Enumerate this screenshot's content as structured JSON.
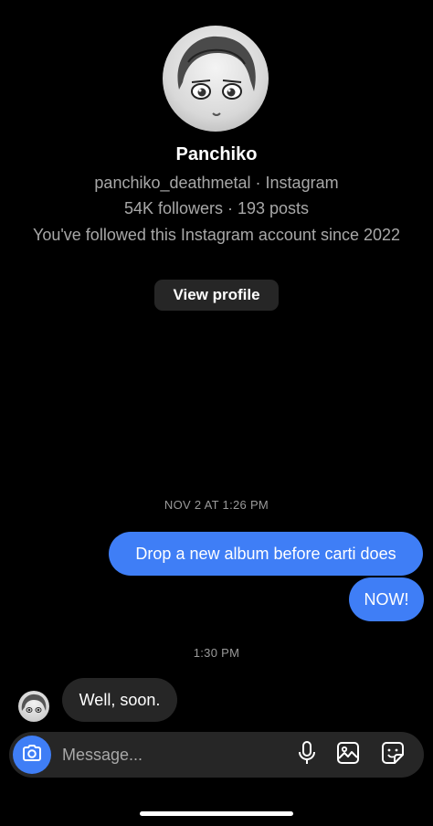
{
  "profile": {
    "display_name": "Panchiko",
    "handle_line": "panchiko_deathmetal · Instagram",
    "stats_line": "54K followers · 193 posts",
    "since_line": "You've followed this Instagram account since 2022",
    "view_profile_label": "View profile"
  },
  "messages": [
    {
      "type": "timestamp",
      "text": "NOV 2 AT 1:26 PM"
    },
    {
      "type": "outgoing",
      "text": "Drop a new album before carti does"
    },
    {
      "type": "outgoing",
      "text": "NOW!"
    },
    {
      "type": "timestamp",
      "text": "1:30 PM"
    },
    {
      "type": "incoming",
      "text": "Well, soon."
    }
  ],
  "composer": {
    "placeholder": "Message...",
    "icons": [
      "camera-icon",
      "microphone-icon",
      "gallery-icon",
      "sticker-icon"
    ]
  },
  "colors": {
    "background": "#000000",
    "outgoing_bubble": "#3f7ef6",
    "incoming_bubble": "#262626",
    "secondary_text": "#a8a8a8"
  }
}
